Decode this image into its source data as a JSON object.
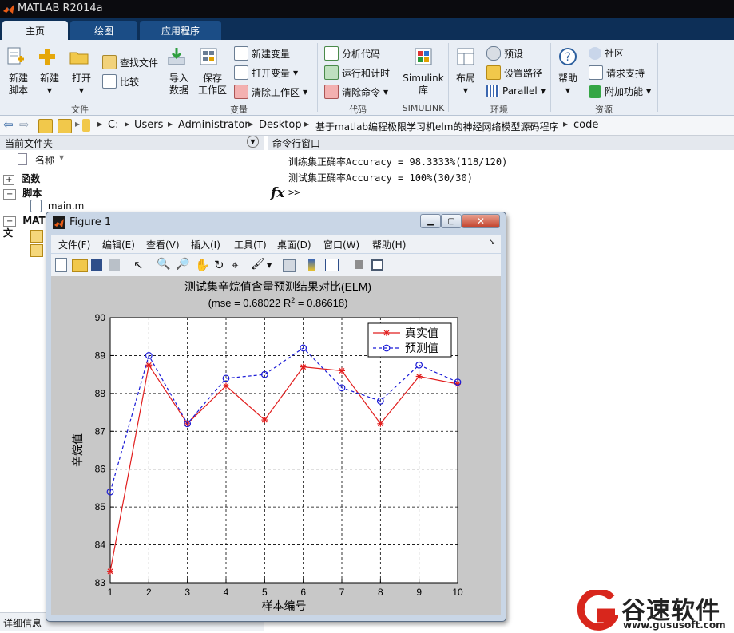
{
  "window": {
    "title": "MATLAB R2014a"
  },
  "tabs": [
    {
      "label": "主页"
    },
    {
      "label": "绘图"
    },
    {
      "label": "应用程序"
    }
  ],
  "ribbon": {
    "file": {
      "new_script": "新建\n脚本",
      "new": "新建",
      "open": "打开",
      "find_files": "查找文件",
      "compare": "比较",
      "group": "文件"
    },
    "variable": {
      "import": "导入\n数据",
      "save_ws": "保存\n工作区",
      "new_var": "新建变量",
      "open_var": "打开变量",
      "clear_ws": "清除工作区",
      "group": "变量"
    },
    "code": {
      "analyze": "分析代码",
      "run_time": "运行和计时",
      "clear_cmd": "清除命令",
      "group": "代码"
    },
    "simulink": {
      "lib": "Simulink\n库",
      "group": "SIMULINK"
    },
    "env": {
      "layout": "布局",
      "prefs": "预设",
      "set_path": "设置路径",
      "parallel": "Parallel",
      "group": "环境"
    },
    "resources": {
      "help": "帮助",
      "community": "社区",
      "support": "请求支持",
      "addons": "附加功能",
      "group": "资源"
    }
  },
  "address": {
    "crumbs": [
      "C:",
      "Users",
      "Administrator",
      "Desktop",
      "基于matlab编程极限学习机elm的神经网络模型源码程序",
      "code"
    ]
  },
  "left_pane": {
    "title": "当前文件夹",
    "col_name": "名称",
    "groups": [
      {
        "label": "函数"
      },
      {
        "label": "脚本"
      },
      {
        "label": "MAT 文"
      }
    ],
    "file": "main.m",
    "footer": "详细信息"
  },
  "command_window": {
    "title": "命令行窗口",
    "lines": [
      "训练集正确率Accuracy = 98.3333%(118/120)",
      "测试集正确率Accuracy = 100%(30/30)"
    ],
    "fx": "fx",
    "prompt": ">>"
  },
  "figure": {
    "title": "Figure 1",
    "menu": [
      "文件(F)",
      "编辑(E)",
      "查看(V)",
      "插入(I)",
      "工具(T)",
      "桌面(D)",
      "窗口(W)",
      "帮助(H)"
    ]
  },
  "chart_data": {
    "type": "line",
    "title": "测试集辛烷值含量预测结果对比(ELM)",
    "subtitle_pre": "(mse = 0.68022 R",
    "subtitle_sup": "2",
    "subtitle_post": " = 0.86618)",
    "xlabel": "样本编号",
    "ylabel": "辛烷值",
    "x": [
      1,
      2,
      3,
      4,
      5,
      6,
      7,
      8,
      9,
      10
    ],
    "xlim": [
      1,
      10
    ],
    "ylim": [
      83,
      90
    ],
    "xticks": [
      "1",
      "2",
      "3",
      "4",
      "5",
      "6",
      "7",
      "8",
      "9",
      "10"
    ],
    "yticks": [
      "83",
      "84",
      "85",
      "86",
      "87",
      "88",
      "89",
      "90"
    ],
    "grid": true,
    "legend_position": "top-right",
    "series": [
      {
        "name": "真实值",
        "color": "#e11d1d",
        "marker": "star",
        "dash": "solid",
        "values": [
          83.3,
          88.75,
          87.2,
          88.2,
          87.3,
          88.7,
          88.6,
          87.2,
          88.45,
          88.25
        ]
      },
      {
        "name": "预测值",
        "color": "#1a1ad6",
        "marker": "circle",
        "dash": "dashed",
        "values": [
          85.4,
          89.0,
          87.2,
          88.4,
          88.5,
          89.2,
          88.15,
          87.8,
          88.75,
          88.3
        ]
      }
    ]
  },
  "watermark": {
    "brand": "谷速软件",
    "url": "www.gususoft.com"
  }
}
